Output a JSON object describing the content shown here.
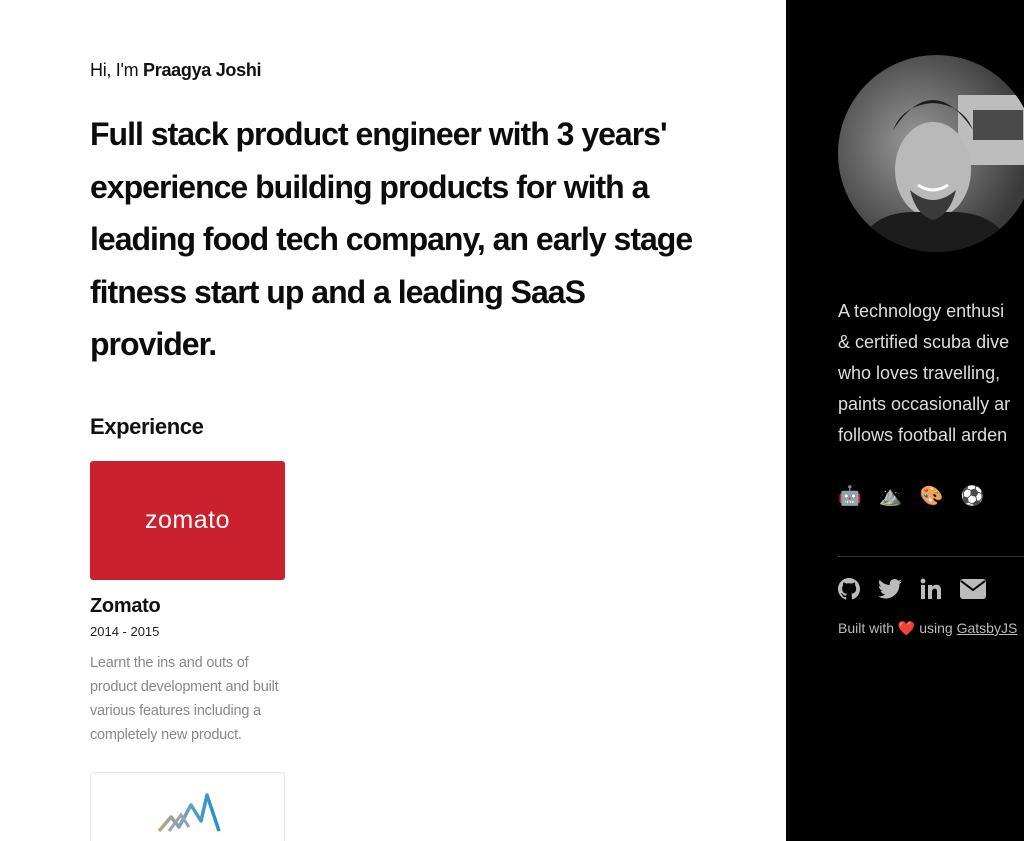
{
  "intro": {
    "greeting_prefix": "Hi, I'm ",
    "name": "Praagya Joshi",
    "headline": "Full stack product engineer with 3 years' experience building products for with a leading food tech company, an early stage fitness start up and a leading SaaS provider."
  },
  "experience": {
    "title": "Experience",
    "items": [
      {
        "logo_text": "zomato",
        "company": "Zomato",
        "years": "2014 - 2015",
        "description": "Learnt the ins and outs of product development and built various features including a completely new product."
      }
    ]
  },
  "sidebar": {
    "bio_lines": [
      "A technology enthusi",
      "& certified scuba dive",
      "who loves travelling,",
      "paints occasionally ar",
      "follows football arden"
    ],
    "emojis": "🤖 ⛰️ 🎨 ⚽",
    "social_icons": [
      "github-icon",
      "twitter-icon",
      "linkedin-icon",
      "mail-icon"
    ],
    "built_prefix": "Built with ",
    "built_heart": "❤️",
    "built_middle": " using ",
    "built_link": "GatsbyJS"
  },
  "colors": {
    "zomato_red": "#cb202d",
    "sidebar_bg": "#000000",
    "heart": "#e0202a"
  }
}
